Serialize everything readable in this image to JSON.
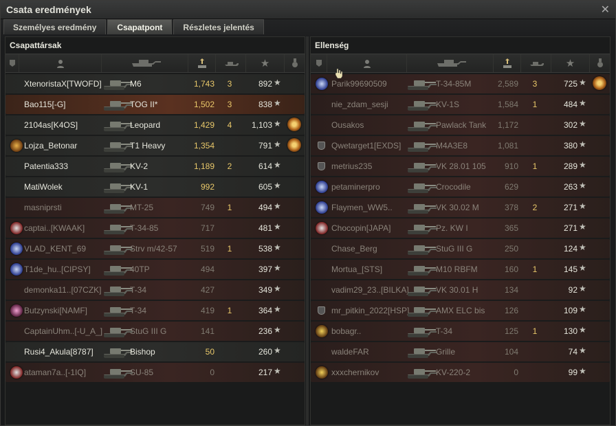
{
  "window": {
    "title": "Csata eredmények"
  },
  "tabs": [
    {
      "label": "Személyes eredmény",
      "active": false
    },
    {
      "label": "Csapatpont",
      "active": true
    },
    {
      "label": "Részletes jelentés",
      "active": false
    }
  ],
  "left": {
    "title": "Csapattársak",
    "rows": [
      {
        "player": "XtenoristaX[TWOFD]",
        "tank": "M6",
        "damage": "1,743",
        "kills": "3",
        "xp": "892",
        "state": "alive",
        "icon": "none",
        "medal": false
      },
      {
        "player": "Bao115[-G]",
        "tank": "TOG II*",
        "damage": "1,502",
        "kills": "3",
        "xp": "838",
        "state": "me",
        "icon": "none",
        "medal": false
      },
      {
        "player": "2104as[K4OS]",
        "tank": "Leopard",
        "damage": "1,429",
        "kills": "4",
        "xp": "1,103",
        "state": "alive",
        "icon": "none",
        "medal": true
      },
      {
        "player": "Lojza_Betonar",
        "tank": "T1 Heavy",
        "damage": "1,354",
        "kills": "",
        "xp": "791",
        "state": "alive",
        "icon": "c2",
        "medal": true
      },
      {
        "player": "Patentia333",
        "tank": "KV-2",
        "damage": "1,189",
        "kills": "2",
        "xp": "614",
        "state": "alive",
        "icon": "none",
        "medal": false
      },
      {
        "player": "MatiWolek",
        "tank": "KV-1",
        "damage": "992",
        "kills": "",
        "xp": "605",
        "state": "alive",
        "icon": "none",
        "medal": false
      },
      {
        "player": "masniprsti",
        "tank": "MT-25",
        "damage": "749",
        "kills": "1",
        "xp": "494",
        "state": "dead",
        "icon": "none",
        "medal": false
      },
      {
        "player": "captai..[KWAAK]",
        "tank": "T-34-85",
        "damage": "717",
        "kills": "",
        "xp": "481",
        "state": "dead",
        "icon": "c3",
        "medal": false
      },
      {
        "player": "VLAD_KENT_69",
        "tank": "Strv m/42-57",
        "damage": "519",
        "kills": "1",
        "xp": "538",
        "state": "dead",
        "icon": "c4",
        "medal": false
      },
      {
        "player": "T1de_hu..[CIPSY]",
        "tank": "40TP",
        "damage": "494",
        "kills": "",
        "xp": "397",
        "state": "dead",
        "icon": "c4",
        "medal": false
      },
      {
        "player": "demonka11..[07CZK]",
        "tank": "T-34",
        "damage": "427",
        "kills": "",
        "xp": "349",
        "state": "dead",
        "icon": "none",
        "medal": false
      },
      {
        "player": "Butzynski[NAMF]",
        "tank": "T-34",
        "damage": "419",
        "kills": "1",
        "xp": "364",
        "state": "dead",
        "icon": "c6",
        "medal": false
      },
      {
        "player": "CaptainUhm..[-U_A_]",
        "tank": "StuG III G",
        "damage": "141",
        "kills": "",
        "xp": "236",
        "state": "dead",
        "icon": "none",
        "medal": false
      },
      {
        "player": "Rusi4_Akula[8787]",
        "tank": "Bishop",
        "damage": "50",
        "kills": "",
        "xp": "260",
        "state": "alive",
        "icon": "none",
        "medal": false
      },
      {
        "player": "ataman7a..[-1IQ]",
        "tank": "SU-85",
        "damage": "0",
        "kills": "",
        "xp": "217",
        "state": "dead",
        "icon": "c3",
        "medal": false
      }
    ]
  },
  "right": {
    "title": "Ellenség",
    "rows": [
      {
        "player": "Parik99690509",
        "tank": "T-34-85M",
        "damage": "2,589",
        "kills": "3",
        "xp": "725",
        "state": "dead",
        "icon": "c4",
        "medal": true
      },
      {
        "player": "nie_zdam_sesji",
        "tank": "KV-1S",
        "damage": "1,584",
        "kills": "1",
        "xp": "484",
        "state": "dead",
        "icon": "none",
        "medal": false
      },
      {
        "player": "Ousakos",
        "tank": "Pawlack Tank",
        "damage": "1,172",
        "kills": "",
        "xp": "302",
        "state": "dead",
        "icon": "none",
        "medal": false
      },
      {
        "player": "Qwetarget1[EXDS]",
        "tank": "M4A3E8",
        "damage": "1,081",
        "kills": "",
        "xp": "380",
        "state": "dead",
        "icon": "badge",
        "medal": false
      },
      {
        "player": "metrius235",
        "tank": "VK 28.01 105",
        "damage": "910",
        "kills": "1",
        "xp": "289",
        "state": "dead",
        "icon": "badge",
        "medal": false
      },
      {
        "player": "petaminerpro",
        "tank": "Crocodile",
        "damage": "629",
        "kills": "",
        "xp": "263",
        "state": "dead",
        "icon": "c4",
        "medal": false
      },
      {
        "player": "Flaymen_WW5..",
        "tank": "VK 30.02 M",
        "damage": "378",
        "kills": "2",
        "xp": "271",
        "state": "dead",
        "icon": "c4",
        "medal": false
      },
      {
        "player": "Chocopin[JAPA]",
        "tank": "Pz. KW I",
        "damage": "365",
        "kills": "",
        "xp": "271",
        "state": "dead",
        "icon": "c3",
        "medal": false
      },
      {
        "player": "Chase_Berg",
        "tank": "StuG III G",
        "damage": "250",
        "kills": "",
        "xp": "124",
        "state": "dead",
        "icon": "none",
        "medal": false
      },
      {
        "player": "Mortua_[STS]",
        "tank": "M10 RBFM",
        "damage": "160",
        "kills": "1",
        "xp": "145",
        "state": "dead",
        "icon": "none",
        "medal": false
      },
      {
        "player": "vadim29_23..[BILKA]",
        "tank": "VK 30.01 H",
        "damage": "134",
        "kills": "",
        "xp": "92",
        "state": "dead",
        "icon": "none",
        "medal": false
      },
      {
        "player": "mr_pitkin_2022[HSP]",
        "tank": "AMX ELC bis",
        "damage": "126",
        "kills": "",
        "xp": "109",
        "state": "dead",
        "icon": "badge",
        "medal": false
      },
      {
        "player": "bobagr..",
        "tank": "T-34",
        "damage": "125",
        "kills": "1",
        "xp": "130",
        "state": "dead",
        "icon": "c5",
        "medal": false
      },
      {
        "player": "waldeFAR",
        "tank": "Grille",
        "damage": "104",
        "kills": "",
        "xp": "74",
        "state": "dead",
        "icon": "none",
        "medal": false
      },
      {
        "player": "xxxchernikov",
        "tank": "KV-220-2",
        "damage": "0",
        "kills": "",
        "xp": "99",
        "state": "dead",
        "icon": "c5",
        "medal": false
      }
    ]
  },
  "glyphs": {
    "star": "★",
    "close": "✕"
  }
}
